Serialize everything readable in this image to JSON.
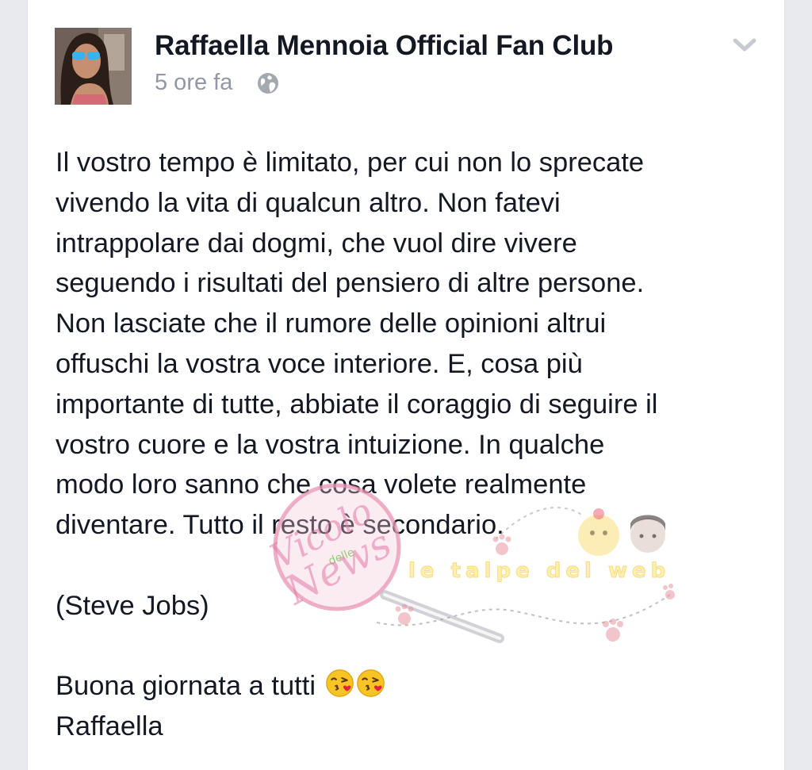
{
  "post": {
    "author": "Raffaella Mennoia Official Fan Club",
    "time": "5 ore fa",
    "privacy_icon": "globe-icon",
    "menu_icon": "chevron-down-icon",
    "text_lines": [
      "Il vostro tempo è limitato, per cui non lo sprecate",
      "vivendo la vita di qualcun altro. Non fatevi",
      "intrappolare dai dogmi, che vuol dire vivere",
      "seguendo i risultati del pensiero di altre persone.",
      "Non lasciate che il rumore delle opinioni altrui",
      "offuschi la vostra voce interiore. E, cosa più",
      "importante di tutte, abbiate il coraggio di seguire il",
      "vostro cuore e la vostra intuizione. In qualche",
      "modo loro sanno che cosa volete realmente",
      "diventare. Tutto il resto è secondario."
    ],
    "quote_author": "(Steve Jobs)",
    "greeting": "Buona giornata a tutti",
    "greeting_emojis": [
      "kissing-face-emoji",
      "kissing-face-emoji"
    ],
    "signature": "Raffaella"
  },
  "watermark": {
    "logo_text_1": "Vicolo",
    "logo_text_2": "delle",
    "logo_text_3": "News",
    "banner_text": "le talpe del web"
  },
  "colors": {
    "text": "#141823",
    "meta": "#9197a3",
    "background": "#e9eaee"
  }
}
